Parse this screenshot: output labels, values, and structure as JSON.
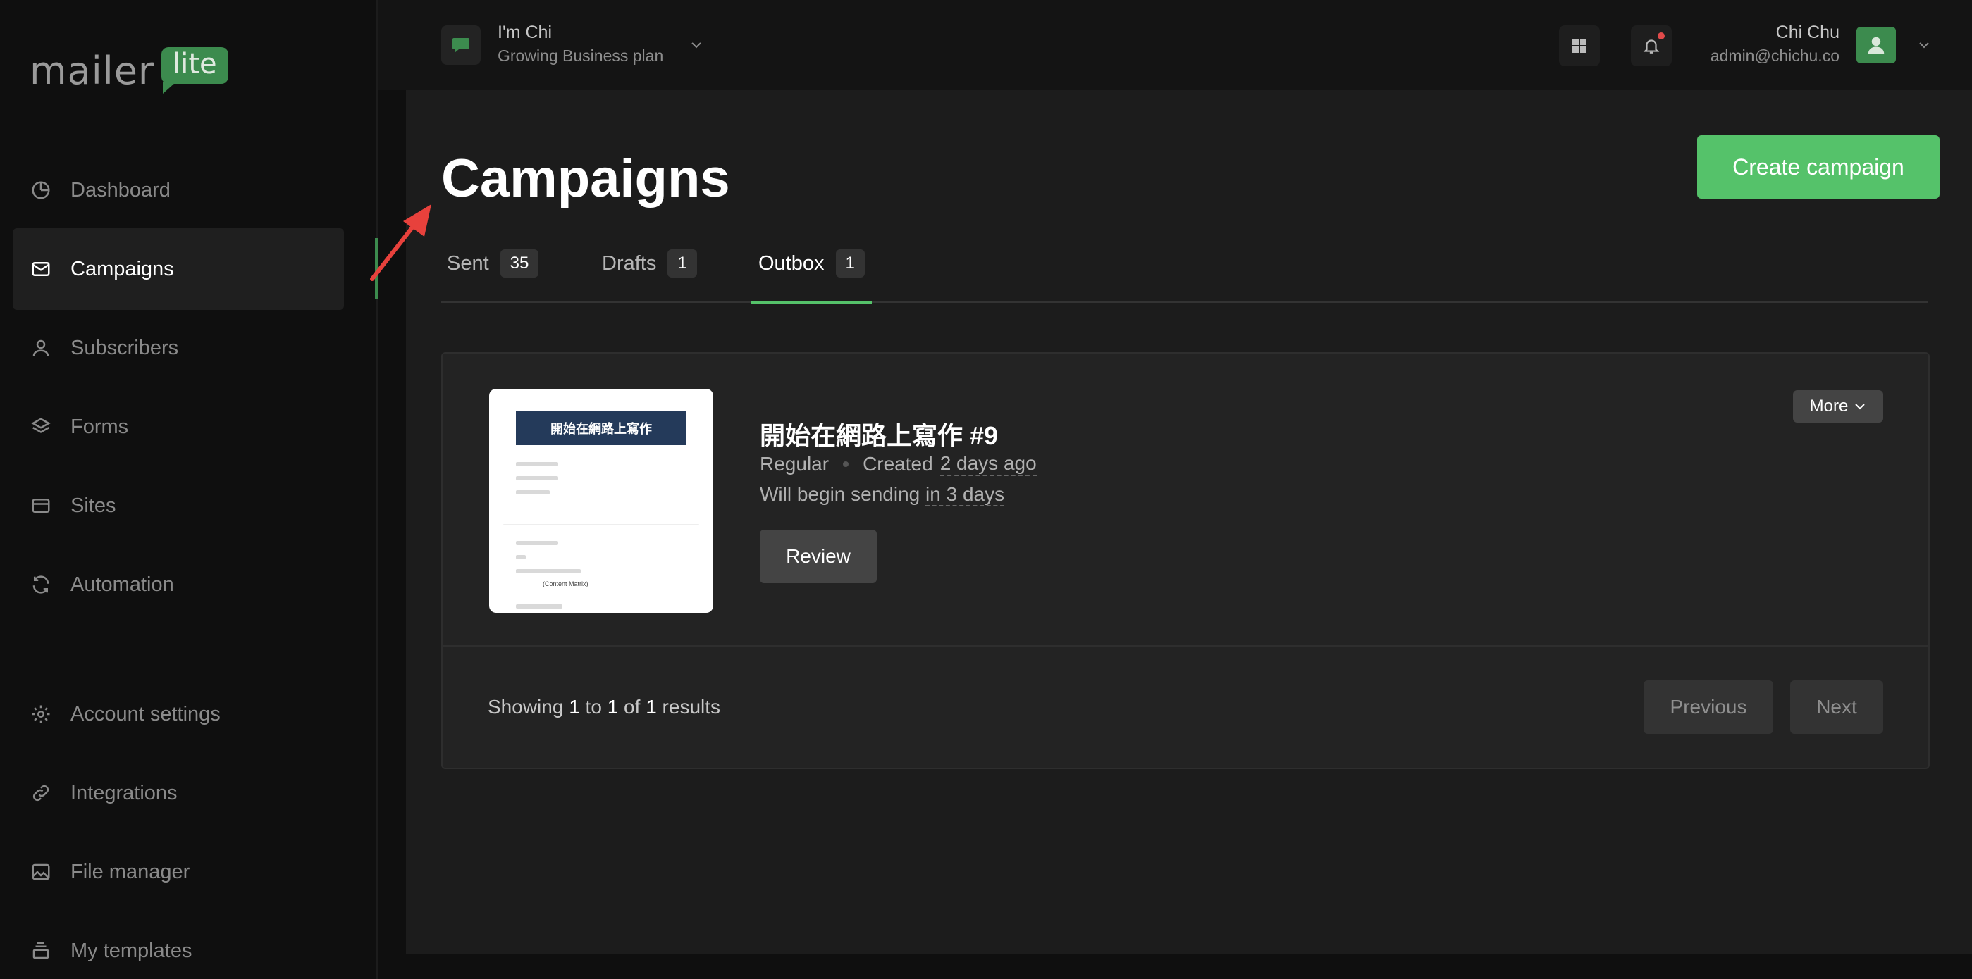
{
  "brand": {
    "word": "mailer",
    "badge": "lite",
    "accent": "#55c26a"
  },
  "workspace": {
    "name": "I'm Chi",
    "plan": "Growing Business plan"
  },
  "user": {
    "name": "Chi Chu",
    "email": "admin@chichu.co"
  },
  "sidebar": {
    "items": [
      {
        "label": "Dashboard",
        "icon": "dashboard-icon",
        "active": false
      },
      {
        "label": "Campaigns",
        "icon": "mail-icon",
        "active": true
      },
      {
        "label": "Subscribers",
        "icon": "person-icon",
        "active": false
      },
      {
        "label": "Forms",
        "icon": "layers-icon",
        "active": false
      },
      {
        "label": "Sites",
        "icon": "browser-icon",
        "active": false
      },
      {
        "label": "Automation",
        "icon": "refresh-icon",
        "active": false
      },
      {
        "label": "Account settings",
        "icon": "gear-icon",
        "active": false
      },
      {
        "label": "Integrations",
        "icon": "link-icon",
        "active": false
      },
      {
        "label": "File manager",
        "icon": "image-icon",
        "active": false
      },
      {
        "label": "My templates",
        "icon": "stack-icon",
        "active": false
      }
    ]
  },
  "page": {
    "title": "Campaigns",
    "create_label": "Create campaign"
  },
  "tabs": [
    {
      "label": "Sent",
      "count": "35",
      "active": false
    },
    {
      "label": "Drafts",
      "count": "1",
      "active": false
    },
    {
      "label": "Outbox",
      "count": "1",
      "active": true
    }
  ],
  "campaign": {
    "title": "開始在網路上寫作 #9",
    "type": "Regular",
    "created_prefix": "Created",
    "created_when": "2 days ago",
    "sched_prefix": "Will begin sending",
    "sched_when": "in 3 days",
    "review_label": "Review",
    "more_label": "More",
    "thumb_banner": "開始在網路上寫作",
    "thumb_caption": "(Content Matrix)"
  },
  "pagination": {
    "showing_prefix": "Showing",
    "from": "1",
    "to_word": "to",
    "to": "1",
    "of_word": "of",
    "total": "1",
    "results_word": "results",
    "previous_label": "Previous",
    "next_label": "Next"
  }
}
